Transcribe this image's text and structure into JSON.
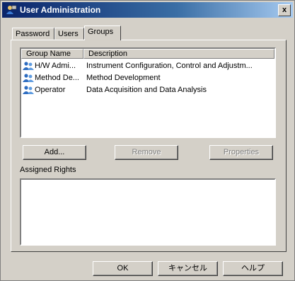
{
  "window": {
    "title": "User Administration",
    "close_label": "x"
  },
  "tabs": [
    {
      "label": "Password"
    },
    {
      "label": "Users"
    },
    {
      "label": "Groups"
    }
  ],
  "list": {
    "columns": [
      "Group Name",
      "Description"
    ],
    "rows": [
      {
        "name": "H/W Admi...",
        "description": "Instrument Configuration, Control and Adjustm..."
      },
      {
        "name": "Method De...",
        "description": "Method Development"
      },
      {
        "name": "Operator",
        "description": "Data Acquisition and Data Analysis"
      }
    ]
  },
  "buttons": {
    "add": "Add...",
    "remove": "Remove",
    "properties": "Properties",
    "ok": "OK",
    "cancel": "キャンセル",
    "help": "ヘルプ"
  },
  "assigned_rights": {
    "label": "Assigned Rights"
  },
  "icons": {
    "group": "users-group-icon",
    "app": "user-admin-icon"
  }
}
